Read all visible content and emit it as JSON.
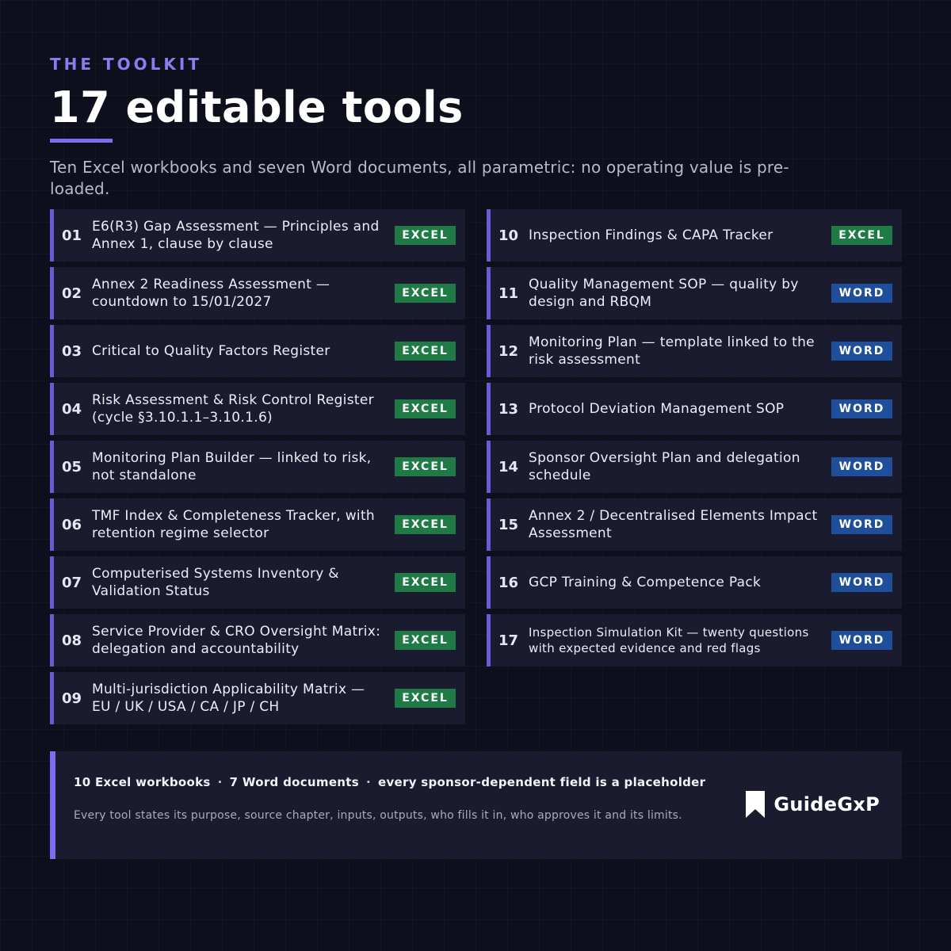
{
  "header": {
    "eyebrow": "THE TOOLKIT",
    "title": "17 editable tools",
    "subtitle": "Ten Excel workbooks and seven Word documents, all parametric: no operating value is pre-loaded."
  },
  "tools_left": [
    {
      "num": "01",
      "name": "E6(R3) Gap Assessment — Principles and Annex 1, clause by clause",
      "type": "EXCEL"
    },
    {
      "num": "02",
      "name": "Annex 2 Readiness Assessment — countdown to 15/01/2027",
      "type": "EXCEL"
    },
    {
      "num": "03",
      "name": "Critical to Quality Factors Register",
      "type": "EXCEL"
    },
    {
      "num": "04",
      "name": "Risk Assessment & Risk Control Register (cycle §3.10.1.1–3.10.1.6)",
      "type": "EXCEL"
    },
    {
      "num": "05",
      "name": "Monitoring Plan Builder — linked to risk, not standalone",
      "type": "EXCEL"
    },
    {
      "num": "06",
      "name": "TMF Index & Completeness Tracker, with retention regime selector",
      "type": "EXCEL"
    },
    {
      "num": "07",
      "name": "Computerised Systems Inventory & Validation Status",
      "type": "EXCEL"
    },
    {
      "num": "08",
      "name": "Service Provider & CRO Oversight Matrix: delegation and accountability",
      "type": "EXCEL"
    },
    {
      "num": "09",
      "name": "Multi-jurisdiction Applicability Matrix — EU / UK / USA / CA / JP / CH",
      "type": "EXCEL"
    }
  ],
  "tools_right": [
    {
      "num": "10",
      "name": "Inspection Findings & CAPA Tracker",
      "type": "EXCEL"
    },
    {
      "num": "11",
      "name": "Quality Management SOP — quality by design and RBQM",
      "type": "WORD"
    },
    {
      "num": "12",
      "name": "Monitoring Plan — template linked to the risk assessment",
      "type": "WORD"
    },
    {
      "num": "13",
      "name": "Protocol Deviation Management SOP",
      "type": "WORD"
    },
    {
      "num": "14",
      "name": "Sponsor Oversight Plan and delegation schedule",
      "type": "WORD"
    },
    {
      "num": "15",
      "name": "Annex 2 / Decentralised Elements Impact Assessment",
      "type": "WORD"
    },
    {
      "num": "16",
      "name": "GCP Training & Competence Pack",
      "type": "WORD"
    },
    {
      "num": "17",
      "name": "Inspection Simulation Kit — twenty questions with expected evidence and red flags",
      "type": "WORD",
      "small": true
    }
  ],
  "footer": {
    "stat_1": "10 Excel workbooks",
    "separator": "·",
    "stat_2": "7 Word documents",
    "stat_3": "every sponsor-dependent field is a placeholder",
    "note": "Every tool states its purpose, source chapter, inputs, outputs, who fills it in, who approves it and its limits."
  },
  "brand": {
    "name": "GuideGxP",
    "icon": "bookmark-icon"
  },
  "colors": {
    "background": "#0e0f1c",
    "accent": "#7b6cf2",
    "excel": "#1f7a45",
    "word": "#1f4f9a"
  }
}
